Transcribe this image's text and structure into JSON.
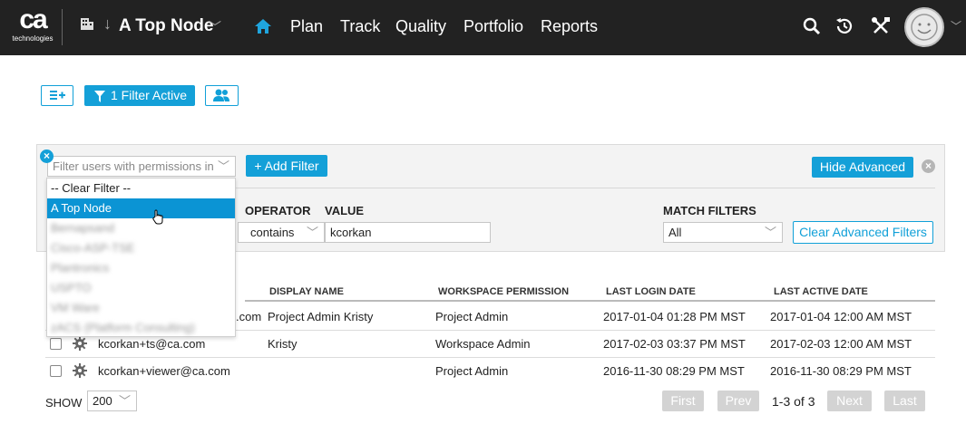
{
  "header": {
    "logo_mark": "ca",
    "logo_subtitle": "technologies",
    "workspace_name": "A Top Node",
    "nav": [
      "Plan",
      "Track",
      "Quality",
      "Portfolio",
      "Reports"
    ],
    "icons": [
      "search-icon",
      "history-icon",
      "tools-icon",
      "avatar-icon"
    ]
  },
  "toolbar": {
    "filter_active_label": "1 Filter Active"
  },
  "filter_panel": {
    "permission_select_placeholder": "Filter users with permissions in",
    "add_filter_label": "+ Add Filter",
    "hide_advanced_label": "Hide Advanced",
    "operator_label": "OPERATOR",
    "value_label": "VALUE",
    "operator_value": "contains",
    "value_input": "kcorkan",
    "match_filters_label": "MATCH FILTERS",
    "match_filters_value": "All",
    "clear_advanced_label": "Clear Advanced Filters"
  },
  "dropdown": {
    "items": [
      {
        "label": "-- Clear Filter --",
        "state": "normal"
      },
      {
        "label": "A Top Node",
        "state": "selected"
      },
      {
        "label": "Bernapsand",
        "state": "blurred"
      },
      {
        "label": "Cisco-ASP-TSE",
        "state": "blurred"
      },
      {
        "label": "Plantronics",
        "state": "blurred"
      },
      {
        "label": "USPTO",
        "state": "blurred"
      },
      {
        "label": "VM Ware",
        "state": "blurred"
      },
      {
        "label": "zACS (Platform Consulting)",
        "state": "blurred"
      }
    ]
  },
  "table": {
    "columns": [
      "DISPLAY NAME",
      "WORKSPACE PERMISSION",
      "LAST LOGIN DATE",
      "LAST ACTIVE DATE"
    ],
    "rows": [
      {
        "user": ".com",
        "display_name": "Project Admin Kristy",
        "permission": "Project Admin",
        "last_login": "2017-01-04 01:28 PM MST",
        "last_active": "2017-01-04 12:00 AM MST"
      },
      {
        "user": "kcorkan+ts@ca.com",
        "display_name": "Kristy",
        "permission": "Workspace Admin",
        "last_login": "2017-02-03 03:37 PM MST",
        "last_active": "2017-02-03 12:00 AM MST"
      },
      {
        "user": "kcorkan+viewer@ca.com",
        "display_name": "",
        "permission": "Project Admin",
        "last_login": "2016-11-30 08:29 PM MST",
        "last_active": "2016-11-30 08:29 PM MST"
      }
    ]
  },
  "footer": {
    "show_label": "SHOW",
    "page_size": "200",
    "first_label": "First",
    "prev_label": "Prev",
    "range_label": "1-3 of 3",
    "next_label": "Next",
    "last_label": "Last"
  },
  "colors": {
    "accent": "#14a0d8",
    "selected_row": "#0b94d4",
    "header_bg": "#222222",
    "disabled_button": "#d3d3d3"
  }
}
